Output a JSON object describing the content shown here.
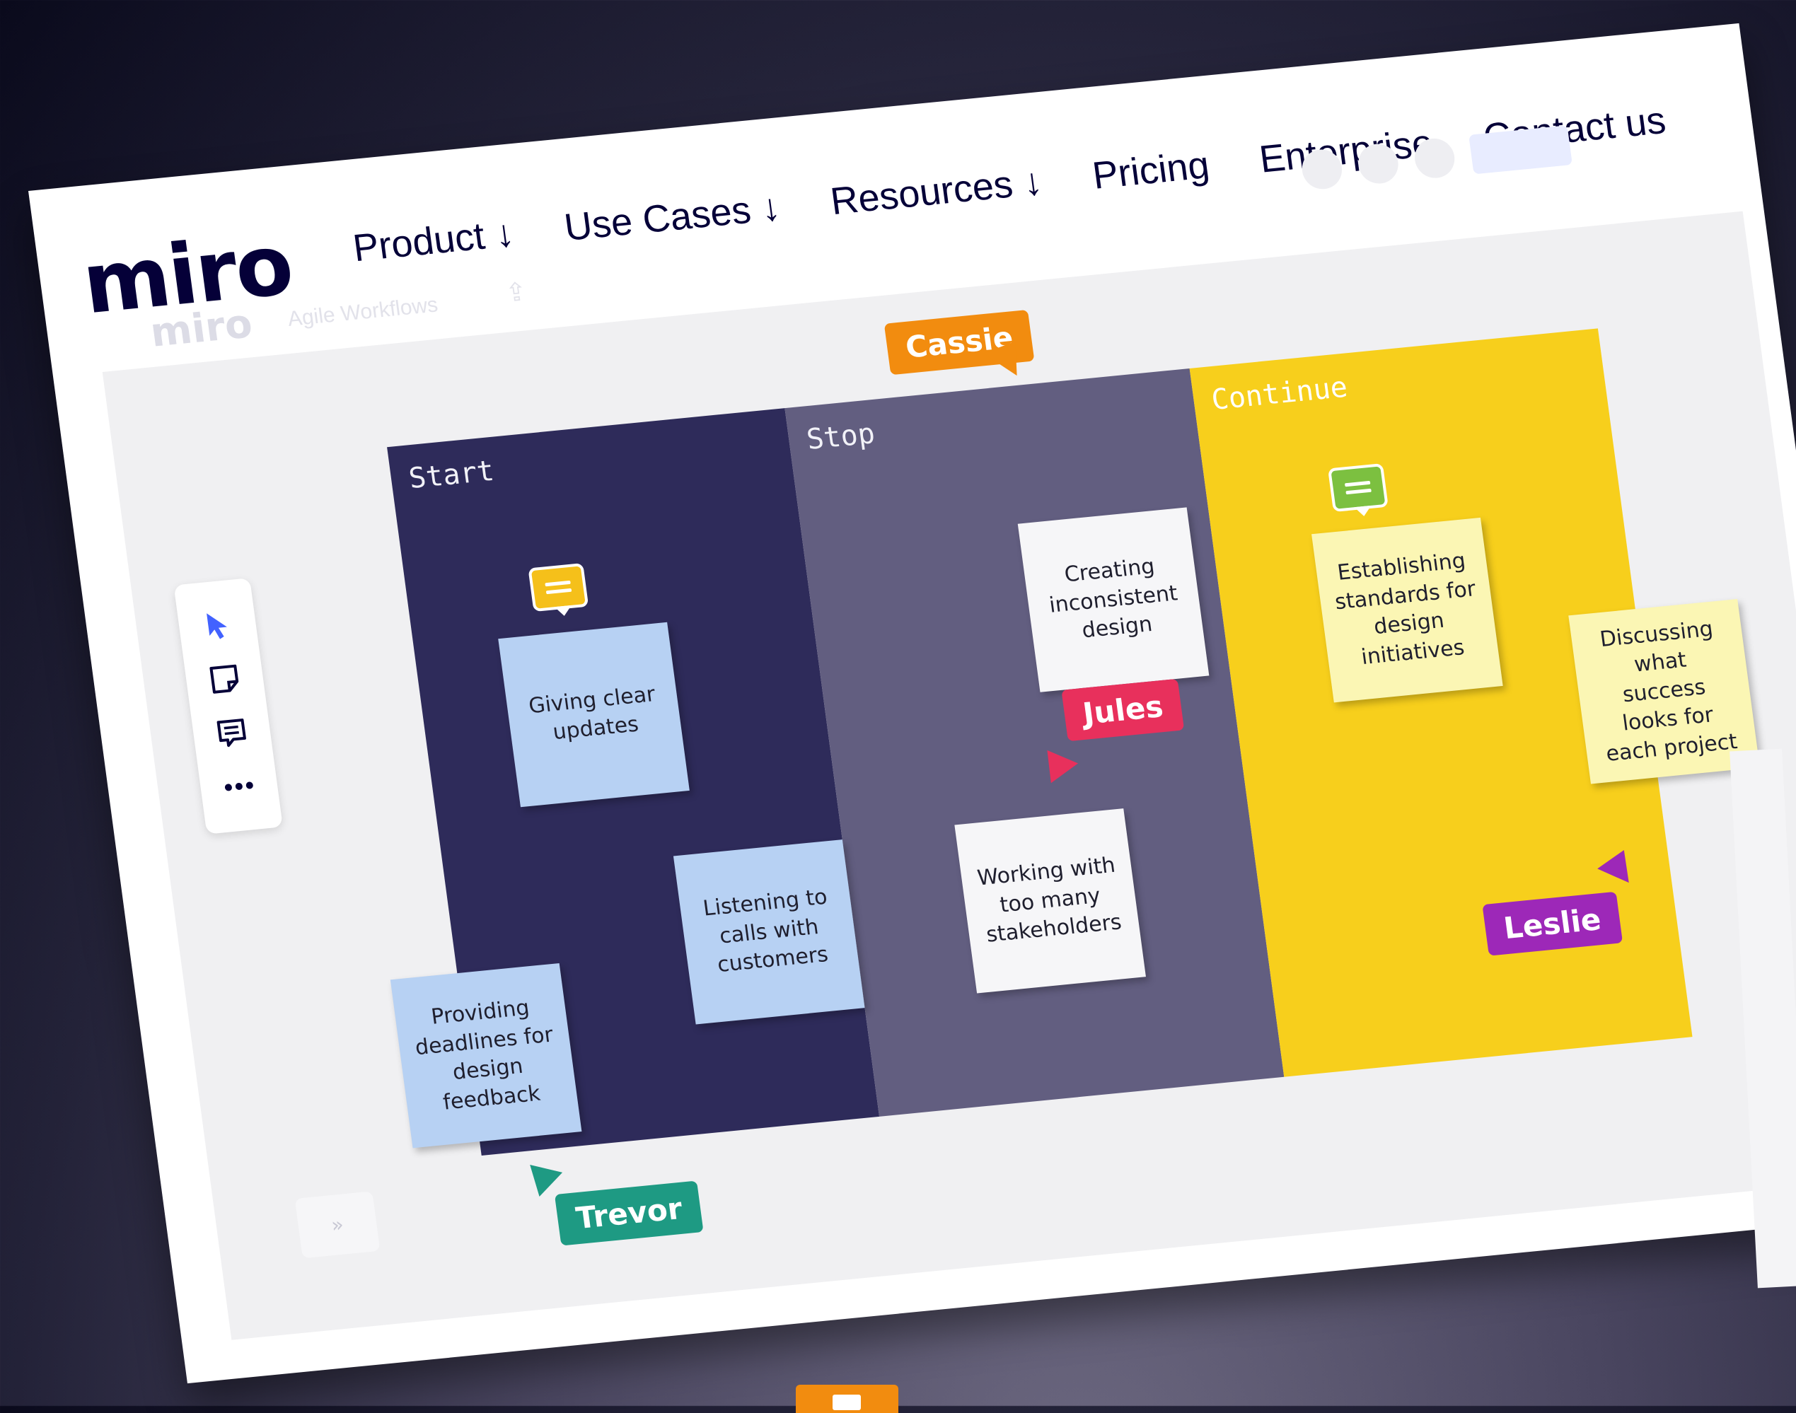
{
  "brand": {
    "logo_text": "miro",
    "board_name": "Agile Workflows"
  },
  "nav": {
    "items": [
      {
        "label": "Product ↓"
      },
      {
        "label": "Use Cases ↓"
      },
      {
        "label": "Resources ↓"
      },
      {
        "label": "Pricing"
      },
      {
        "label": "Enterprise"
      },
      {
        "label": "Contact us"
      }
    ]
  },
  "board": {
    "columns": [
      {
        "label": "Start",
        "color": "#2e2b5a"
      },
      {
        "label": "Stop",
        "color": "#625e80"
      },
      {
        "label": "Continue",
        "color": "#f7cf1c"
      }
    ],
    "stickies": {
      "giving_clear_updates": "Giving clear updates",
      "listening_to_calls": "Listening to calls with customers",
      "providing_deadlines": "Providing deadlines for design feedback",
      "creating_inconsistent": "Creating inconsistent design",
      "working_with_stakeholders": "Working with too many stakeholders",
      "establishing_standards": "Establishing standards for design initiatives",
      "discussing_success": "Discussing what success looks for each project"
    },
    "cursors": [
      {
        "name": "Cassie",
        "color": "#f28c0f"
      },
      {
        "name": "Jules",
        "color": "#e8305c"
      },
      {
        "name": "Leslie",
        "color": "#9d28b8"
      },
      {
        "name": "Trevor",
        "color": "#1e9a83"
      }
    ]
  },
  "toolbar": {
    "tools": [
      {
        "icon": "cursor-icon"
      },
      {
        "icon": "sticky-note-icon"
      },
      {
        "icon": "comment-icon"
      },
      {
        "icon": "more-icon"
      }
    ],
    "expand_label": "»"
  },
  "colors": {
    "brand_dark": "#050038",
    "sticky_blue": "#b7d1f3",
    "sticky_yellow": "#fbf6b4",
    "sticky_white": "#f6f6f8",
    "comment_yellow": "#f5c01a",
    "comment_green": "#7cc040"
  }
}
